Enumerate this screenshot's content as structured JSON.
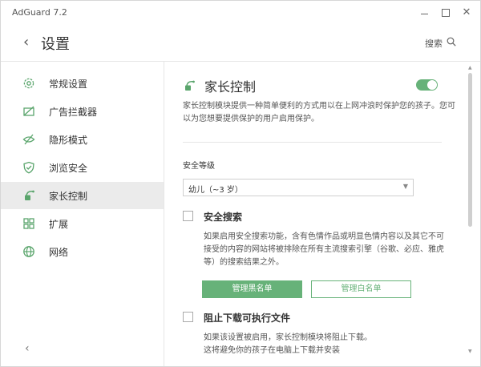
{
  "window": {
    "title": "AdGuard 7.2",
    "close_glyph": "✕"
  },
  "header": {
    "back_glyph": "‹",
    "title": "设置",
    "search_label": "搜索"
  },
  "sidebar": {
    "items": [
      {
        "label": "常规设置",
        "icon": "gear-icon"
      },
      {
        "label": "广告拦截器",
        "icon": "ad-blocker-icon"
      },
      {
        "label": "隐形模式",
        "icon": "stealth-eye-icon"
      },
      {
        "label": "浏览安全",
        "icon": "shield-icon"
      },
      {
        "label": "家长控制",
        "icon": "parental-control-icon",
        "active": true
      },
      {
        "label": "扩展",
        "icon": "extensions-icon"
      },
      {
        "label": "网络",
        "icon": "globe-icon"
      }
    ],
    "collapse_glyph": "‹"
  },
  "main": {
    "title": "家长控制",
    "enabled": true,
    "description": "家长控制模块提供一种简单便利的方式用以在上网冲浪时保护您的孩子。您可以为您想要提供保护的用户启用保护。",
    "level_label": "安全等级",
    "level_value": "幼儿（~3 岁）",
    "safe_search": {
      "title": "安全搜索",
      "checked": false,
      "description": "如果启用安全搜索功能，含有色情作品或明显色情内容以及其它不可接受的内容的网站将被排除在所有主流搜索引擎（谷歌、必应、雅虎等）的搜索结果之外。"
    },
    "buttons": {
      "blacklist": "管理黑名单",
      "whitelist": "管理白名单"
    },
    "block_exe": {
      "title": "阻止下载可执行文件",
      "checked": false,
      "description": "如果该设置被启用，家长控制模块将阻止下载。这将避免你的孩子在电脑上下载并安装"
    }
  },
  "colors": {
    "accent": "#67b279",
    "active_bg": "#ebebeb",
    "text": "#333333"
  }
}
